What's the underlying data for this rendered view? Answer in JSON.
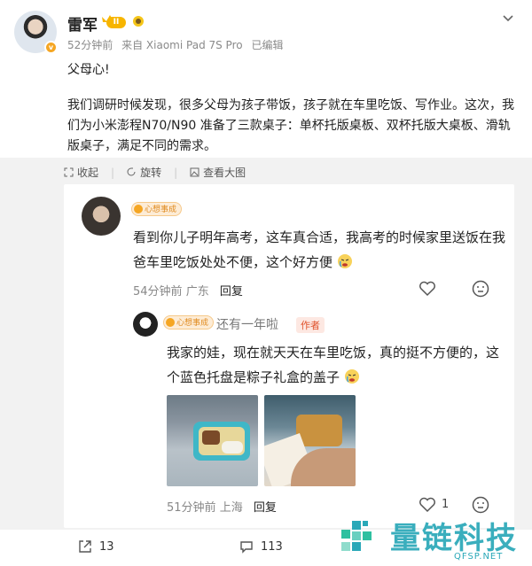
{
  "post": {
    "author_name": "雷军",
    "level_badge": "II",
    "time": "52分钟前",
    "source": "来自 Xiaomi Pad 7S Pro",
    "edited": "已编辑",
    "first_line": "父母心!",
    "body": "我们调研时候发现，很多父母为孩子带饭，孩子就在车里吃饭、写作业。这次，我们为小米澎程N70/N90 准备了三款桌子：单杯托版桌板、双杯托版大桌板、滑轨版桌子，满足不同的需求。"
  },
  "post_actions": {
    "collect": "收起",
    "rotate": "旋转",
    "view_large": "查看大图"
  },
  "comment": {
    "badge": "心想事成",
    "text": "看到你儿子明年高考，这车真合适，我高考的时候家里送饭在我爸车里吃饭处处不便，这个好方便",
    "time": "54分钟前",
    "location": "广东",
    "reply_label": "回复"
  },
  "reply": {
    "badge": "心想事成",
    "name": "还有一年啦",
    "author_tag": "作者",
    "text": "我家的娃，现在就天天在车里吃饭，真的挺不方便的，这个蓝色托盘是粽子礼盒的盖子",
    "time": "51分钟前",
    "location": "上海",
    "reply_label": "回复",
    "like_count": "1"
  },
  "bottom_bar": {
    "share_count": "13",
    "comment_count": "113"
  },
  "watermark": {
    "text": "量链科技",
    "url": "QFSP.NET"
  },
  "colors": {
    "accent_orange": "#f5a623",
    "author_tag": "#e0522c",
    "watermark": "#2aa8b8"
  },
  "icons": [
    "avatar",
    "verified-badge-icon",
    "crown-icon",
    "chevron-down-icon",
    "collapse-icon",
    "rotate-icon",
    "view-image-icon",
    "heart-icon",
    "dislike-face-icon",
    "crying-emoji-icon",
    "share-icon",
    "comment-icon"
  ]
}
